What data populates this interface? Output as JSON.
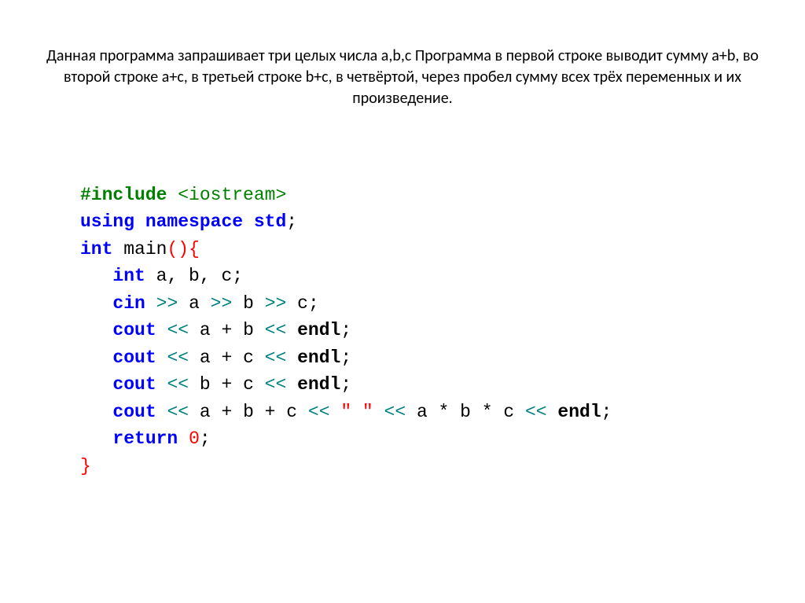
{
  "description": "Данная программа запрашивает три целых числа a,b,c  Программа в первой строке выводит сумму a+b, во второй строке a+c, в третьей строке b+c, в четвёртой, через пробел сумму всех трёх переменных и их произведение.",
  "code": {
    "line1": {
      "include": "#include",
      "header": "<iostream>"
    },
    "line2": {
      "using": "using",
      "namespace": "namespace",
      "std": "std",
      "semi": ";"
    },
    "line3": {
      "int": "int",
      "main": "main",
      "lparen": "(",
      "rparen": ")",
      "lbrace": "{"
    },
    "line4": {
      "indent": "   ",
      "int": "int",
      "vars": " a, b, c",
      "semi": ";"
    },
    "line5": {
      "indent": "   ",
      "cin": "cin",
      "op1": " >> ",
      "a": "a",
      "op2": " >> ",
      "b": "b",
      "op3": " >> ",
      "c": "c",
      "semi": ";"
    },
    "line6": {
      "indent": "   ",
      "cout": "cout",
      "op1": " << ",
      "expr": "a + b",
      "op2": " << ",
      "endl": "endl",
      "semi": ";"
    },
    "line7": {
      "indent": "   ",
      "cout": "cout",
      "op1": " << ",
      "expr": "a + c",
      "op2": " << ",
      "endl": "endl",
      "semi": ";"
    },
    "line8": {
      "indent": "   ",
      "cout": "cout",
      "op1": " << ",
      "expr": "b + c",
      "op2": " << ",
      "endl": "endl",
      "semi": ";"
    },
    "line9": {
      "indent": "   ",
      "cout": "cout",
      "op1": " << ",
      "expr1": "a + b + c",
      "op2": " << ",
      "str": "\" \"",
      "op3": " << ",
      "expr2": "a * b * c",
      "op4": " << ",
      "endl": "endl",
      "semi": ";"
    },
    "line10": {
      "indent": "   ",
      "return": "return",
      "sp": " ",
      "zero": "0",
      "semi": ";"
    },
    "line11": {
      "rbrace": "}"
    }
  }
}
